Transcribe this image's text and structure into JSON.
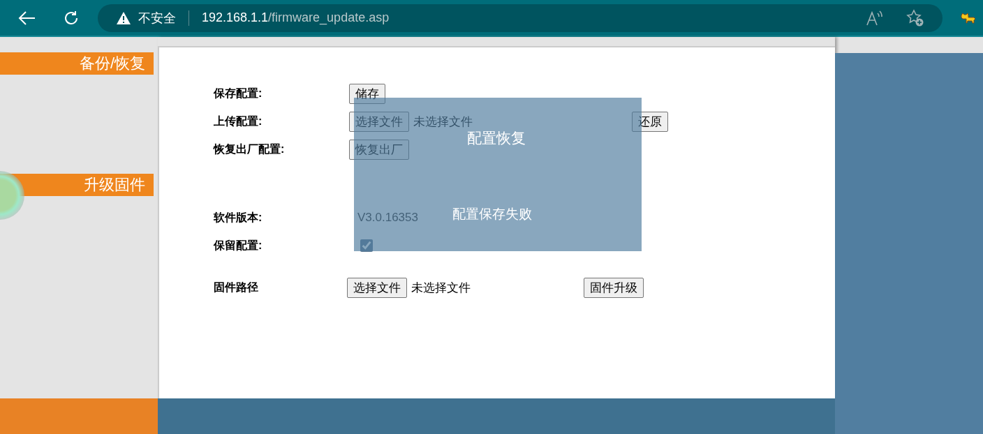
{
  "browser": {
    "security_label": "不安全",
    "url_host": "192.168.1.1",
    "url_path": "/firmware_update.asp"
  },
  "sidebar": {
    "items": [
      {
        "label": "备份/恢复"
      },
      {
        "label": "升级固件"
      }
    ]
  },
  "form": {
    "save_config": {
      "label": "保存配置:",
      "button": "储存"
    },
    "upload_config": {
      "label": "上传配置:",
      "file_button": "选择文件",
      "file_status": "未选择文件",
      "button": "还原"
    },
    "factory_reset": {
      "label": "恢复出厂配置:",
      "button": "恢复出厂"
    },
    "software_version": {
      "label": "软件版本:",
      "value": "V3.0.16353"
    },
    "keep_config": {
      "label": "保留配置:",
      "checked": true
    },
    "firmware": {
      "label": "固件路径",
      "file_button": "选择文件",
      "file_status": "未选择文件",
      "button": "固件升级"
    }
  },
  "overlay": {
    "title": "配置恢复",
    "message": "配置保存失败"
  }
}
